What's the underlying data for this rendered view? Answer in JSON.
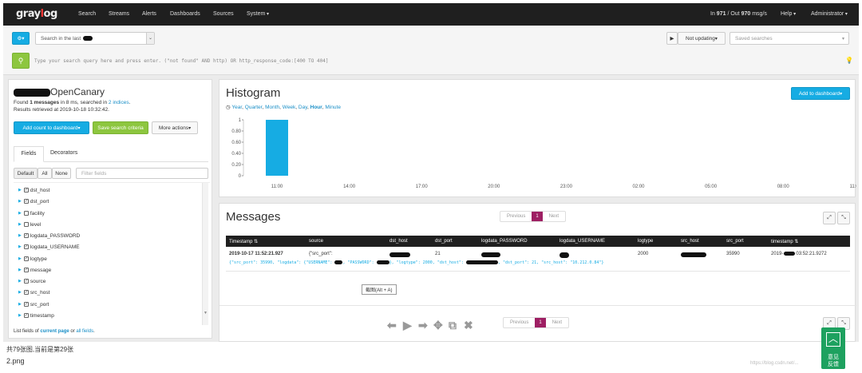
{
  "nav": {
    "logo_prefix": "gray",
    "logo_o": "l",
    "logo_suffix": "og",
    "items": [
      "Search",
      "Streams",
      "Alerts",
      "Dashboards",
      "Sources",
      "System"
    ],
    "throughput_in_label": "In",
    "throughput_in": "971",
    "throughput_out_label": "/ Out",
    "throughput_out": "970",
    "throughput_unit": "msg/s",
    "help": "Help",
    "user": "Administrator"
  },
  "search": {
    "range_prefix": "Search in the last",
    "query_placeholder": "Type your search query here and press enter. (\"not found\" AND http) OR http_response_code:[400 TO 404]",
    "not_updating": "Not updating",
    "saved_searches_placeholder": "Saved searches"
  },
  "sidebar": {
    "stream_title": "OpenCanary",
    "found_pre": "Found",
    "found_count": "1 messages",
    "found_mid": "in 8 ms, searched in",
    "found_indices": "2 indices",
    "retrieved": "Results retrieved at 2019-10-18 10:32:42.",
    "add_count_btn": "Add count to dashboard",
    "save_search_btn": "Save search criteria",
    "more_actions_btn": "More actions",
    "tabs": [
      "Fields",
      "Decorators"
    ],
    "filter_buttons": [
      "Default",
      "All",
      "None"
    ],
    "filter_placeholder": "Filter fields",
    "fields": [
      {
        "name": "dst_host",
        "checked": true
      },
      {
        "name": "dst_port",
        "checked": true
      },
      {
        "name": "facility",
        "checked": false
      },
      {
        "name": "level",
        "checked": false
      },
      {
        "name": "logdata_PASSWORD",
        "checked": true
      },
      {
        "name": "logdata_USERNAME",
        "checked": true
      },
      {
        "name": "logtype",
        "checked": true
      },
      {
        "name": "message",
        "checked": true
      },
      {
        "name": "source",
        "checked": true
      },
      {
        "name": "src_host",
        "checked": true
      },
      {
        "name": "src_port",
        "checked": true
      },
      {
        "name": "timestamp",
        "checked": true
      }
    ],
    "list_fields_pre": "List fields of",
    "list_fields_current": "current page",
    "list_fields_or": "or",
    "list_fields_all": "all fields"
  },
  "histogram": {
    "title": "Histogram",
    "resolutions": [
      "Year",
      "Quarter",
      "Month",
      "Week",
      "Day",
      "Hour",
      "Minute"
    ],
    "active_resolution": "Hour",
    "add_to_dashboard": "Add to dashboard",
    "bar_color": "#16ace3"
  },
  "chart_data": {
    "type": "bar",
    "x": [
      "11:00"
    ],
    "values": [
      1
    ],
    "x_ticks": [
      "11:00",
      "14:00",
      "17:00",
      "20:00",
      "23:00",
      "02:00",
      "05:00",
      "08:00",
      "11:00"
    ],
    "y_ticks": [
      "1",
      "0.80",
      "0.60",
      "0.40",
      "0.20",
      "0"
    ],
    "ylim": [
      0,
      1
    ]
  },
  "messages": {
    "title": "Messages",
    "pager": {
      "previous": "Previous",
      "page": "1",
      "next": "Next"
    },
    "columns": [
      "Timestamp",
      "source",
      "dst_host",
      "dst_port",
      "logdata_PASSWORD",
      "logdata_USERNAME",
      "logtype",
      "src_host",
      "src_port",
      "timestamp"
    ],
    "row": {
      "timestamp": "2019-10-17 11:52:21.927",
      "source": "{\"src_port\":",
      "dst_port": "21",
      "logtype": "2000",
      "src_port": "35990",
      "timestamp2_pre": "2019-",
      "timestamp2_post": "03:52:21.9272",
      "message_pre": "{\"src_port\": 35990, \"logdata\": {\"USERNAME\":",
      "message_mid": ", \"PASSWORD\":",
      "message_mid2": "}, \"logtype\": 2000, \"dst_host\":",
      "message_post": ", \"dst_port\": 21, \"src_host\": \"10.212.0.84\"}"
    },
    "tooltip": "截图(Alt + A)"
  },
  "page_footer": {
    "counter": "共79张图,当前是第29张",
    "filename": "2.png",
    "feedback": "意见\n反馈",
    "watermark": "https://blog.csdn.net/..."
  },
  "colors": {
    "accent": "#16ace3",
    "nav_bg": "#1f1f1f",
    "pager_active": "#9e1f63",
    "green": "#8dc63f"
  }
}
